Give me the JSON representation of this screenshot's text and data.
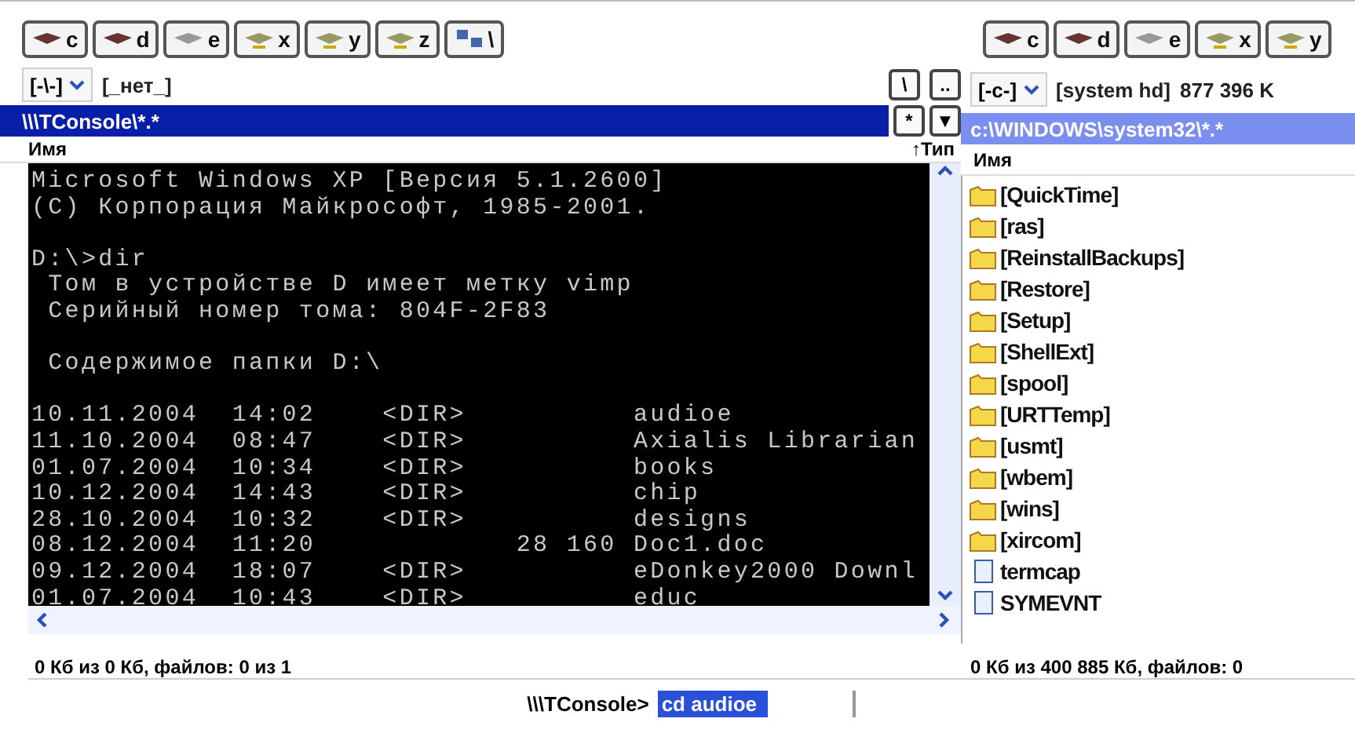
{
  "left_panel": {
    "drives": [
      {
        "letter": "c",
        "kind": "hdd"
      },
      {
        "letter": "d",
        "kind": "hdd"
      },
      {
        "letter": "e",
        "kind": "cd"
      },
      {
        "letter": "x",
        "kind": "net"
      },
      {
        "letter": "y",
        "kind": "net"
      },
      {
        "letter": "z",
        "kind": "net"
      },
      {
        "letter": "\\",
        "kind": "network"
      }
    ],
    "drive_combo": "[-\\-]",
    "drive_label": "[_нет_]",
    "root_button": "\\",
    "up_button": "..",
    "path": "\\\\\\TConsole\\*.*",
    "path_active": true,
    "filter_button": "*",
    "history_button": "▼",
    "columns": [
      {
        "label": "Имя"
      },
      {
        "label": "↑Тип"
      }
    ],
    "console": {
      "blocks": [
        [
          "Microsoft Windows XP [Версия 5.1.2600]",
          "(C) Корпорация Майкрософт, 1985-2001."
        ],
        [
          "D:\\>dir",
          " Том в устройстве D имеет метку vimp",
          " Серийный номер тома: 804F-2F83"
        ],
        [
          " Содержимое папки D:\\"
        ],
        [
          "10.11.2004  14:02    <DIR>          audioe",
          "11.10.2004  08:47    <DIR>          Axialis Librarian",
          "01.07.2004  10:34    <DIR>          books",
          "10.12.2004  14:43    <DIR>          chip",
          "28.10.2004  10:32    <DIR>          designs",
          "08.12.2004  11:20            28 160 Doc1.doc",
          "09.12.2004  18:07    <DIR>          eDonkey2000 Downl",
          "01.07.2004  10:43    <DIR>          educ"
        ]
      ]
    },
    "status": "0 Кб из 0 Кб, файлов: 0 из 1"
  },
  "right_panel": {
    "drives": [
      {
        "letter": "c",
        "kind": "hdd"
      },
      {
        "letter": "d",
        "kind": "hdd"
      },
      {
        "letter": "e",
        "kind": "cd"
      },
      {
        "letter": "x",
        "kind": "net"
      },
      {
        "letter": "y",
        "kind": "net"
      }
    ],
    "drive_combo": "[-c-]",
    "drive_label": "[system hd]",
    "free_space": "877 396 K",
    "path": "c:\\WINDOWS\\system32\\*.*",
    "path_active": false,
    "columns": [
      {
        "label": "Имя"
      }
    ],
    "files": [
      {
        "name": "[QuickTime]",
        "kind": "folder"
      },
      {
        "name": "[ras]",
        "kind": "folder"
      },
      {
        "name": "[ReinstallBackups]",
        "kind": "folder"
      },
      {
        "name": "[Restore]",
        "kind": "folder"
      },
      {
        "name": "[Setup]",
        "kind": "folder"
      },
      {
        "name": "[ShellExt]",
        "kind": "folder"
      },
      {
        "name": "[spool]",
        "kind": "folder"
      },
      {
        "name": "[URTTemp]",
        "kind": "folder"
      },
      {
        "name": "[usmt]",
        "kind": "folder"
      },
      {
        "name": "[wbem]",
        "kind": "folder"
      },
      {
        "name": "[wins]",
        "kind": "folder"
      },
      {
        "name": "[xircom]",
        "kind": "folder"
      },
      {
        "name": "termcap",
        "kind": "file"
      },
      {
        "name": "SYMEVNT",
        "kind": "file"
      }
    ],
    "status": "0 Кб из 400 885 Кб, файлов: 0"
  },
  "command_line": {
    "prompt": "\\\\\\TConsole>",
    "value": "cd audioe"
  }
}
